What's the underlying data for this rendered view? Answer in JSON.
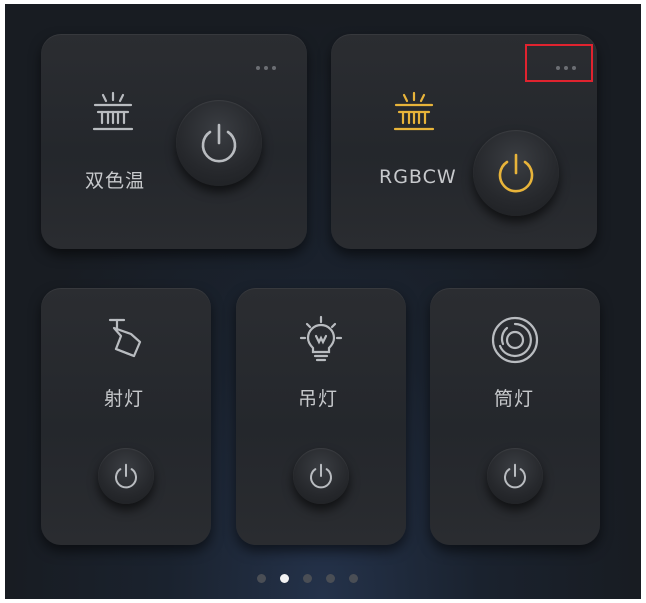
{
  "colors": {
    "accent_yellow": "#e8b43a",
    "icon_grey": "#b9bcc0",
    "highlight_red": "#e0232f"
  },
  "cards": [
    {
      "label": "双色温",
      "icon": "bar-light-icon",
      "state": "off"
    },
    {
      "label": "RGBCW",
      "icon": "bar-light-icon",
      "state": "on"
    },
    {
      "label": "射灯",
      "icon": "spotlight-icon",
      "state": "off"
    },
    {
      "label": "吊灯",
      "icon": "bulb-icon",
      "state": "off"
    },
    {
      "label": "筒灯",
      "icon": "downlight-icon",
      "state": "off"
    }
  ],
  "pager": {
    "count": 5,
    "active_index": 1
  }
}
